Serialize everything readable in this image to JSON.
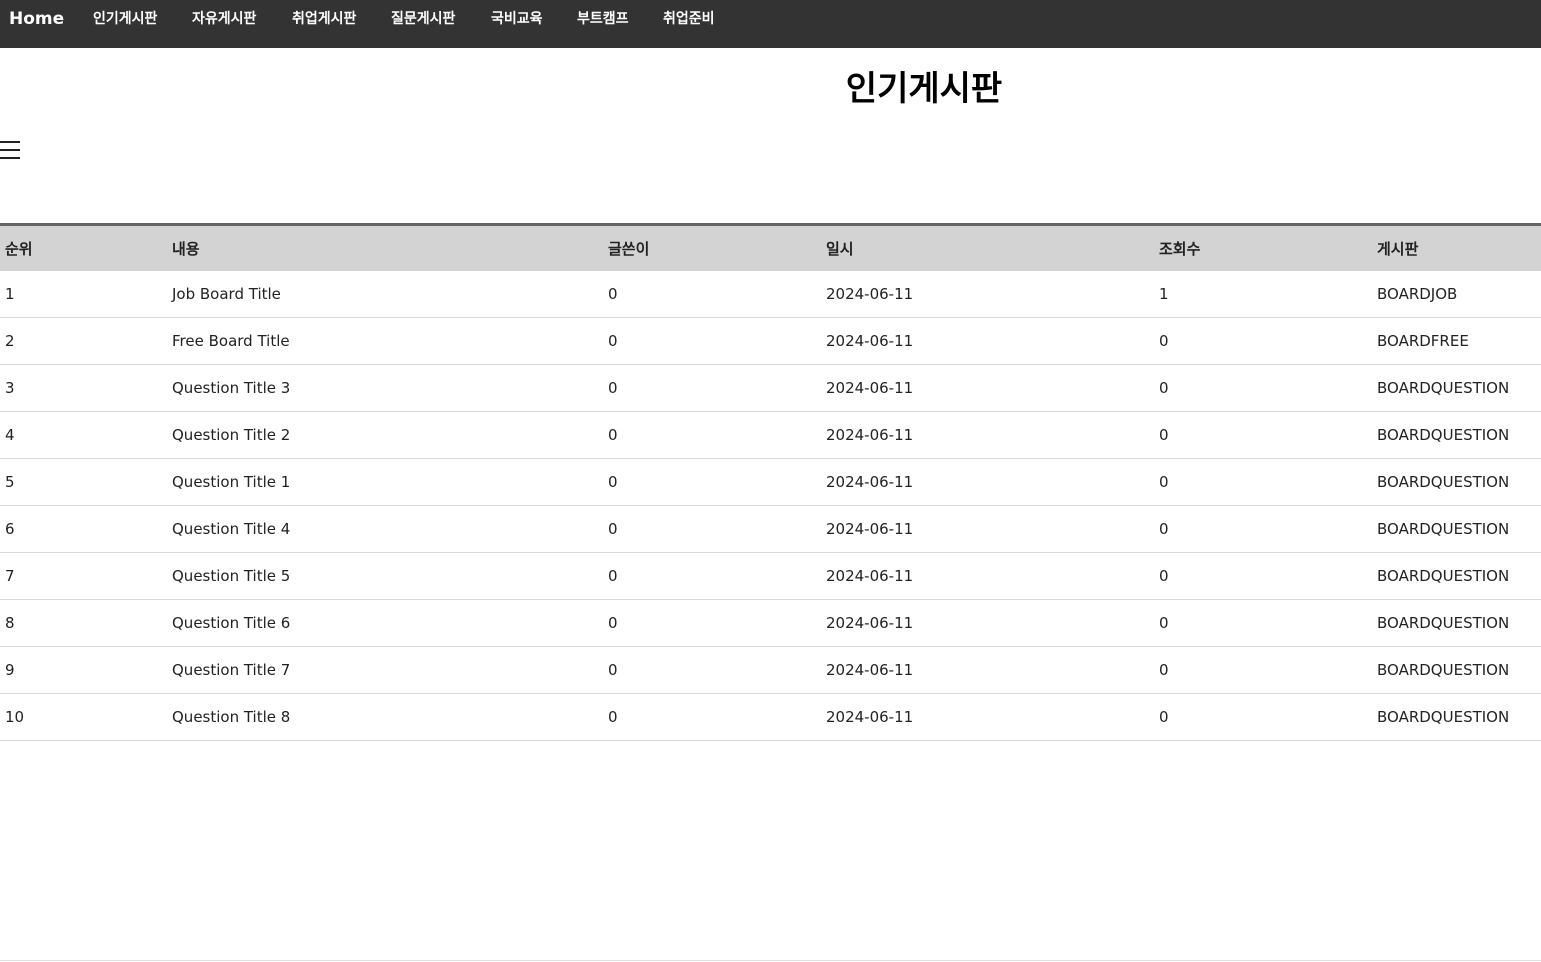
{
  "nav": {
    "items": [
      {
        "label": "Home"
      },
      {
        "label": "인기게시판"
      },
      {
        "label": "자유게시판"
      },
      {
        "label": "취업게시판"
      },
      {
        "label": "질문게시판"
      },
      {
        "label": "국비교육"
      },
      {
        "label": "부트캠프"
      },
      {
        "label": "취업준비"
      }
    ]
  },
  "page": {
    "title": "인기게시판",
    "menu_icon": "☰"
  },
  "colors": {
    "nav_bg": "#333333",
    "header_bg": "#d3d3d3"
  },
  "table": {
    "headers": [
      "순위",
      "내용",
      "글쓴이",
      "일시",
      "조회수",
      "게시판"
    ],
    "rows": [
      [
        "1",
        "Job Board Title",
        "0",
        "2024-06-11",
        "1",
        "BOARDJOB"
      ],
      [
        "2",
        "Free Board Title",
        "0",
        "2024-06-11",
        "0",
        "BOARDFREE"
      ],
      [
        "3",
        "Question Title 3",
        "0",
        "2024-06-11",
        "0",
        "BOARDQUESTION"
      ],
      [
        "4",
        "Question Title 2",
        "0",
        "2024-06-11",
        "0",
        "BOARDQUESTION"
      ],
      [
        "5",
        "Question Title 1",
        "0",
        "2024-06-11",
        "0",
        "BOARDQUESTION"
      ],
      [
        "6",
        "Question Title 4",
        "0",
        "2024-06-11",
        "0",
        "BOARDQUESTION"
      ],
      [
        "7",
        "Question Title 5",
        "0",
        "2024-06-11",
        "0",
        "BOARDQUESTION"
      ],
      [
        "8",
        "Question Title 6",
        "0",
        "2024-06-11",
        "0",
        "BOARDQUESTION"
      ],
      [
        "9",
        "Question Title 7",
        "0",
        "2024-06-11",
        "0",
        "BOARDQUESTION"
      ],
      [
        "10",
        "Question Title 8",
        "0",
        "2024-06-11",
        "0",
        "BOARDQUESTION"
      ]
    ]
  }
}
